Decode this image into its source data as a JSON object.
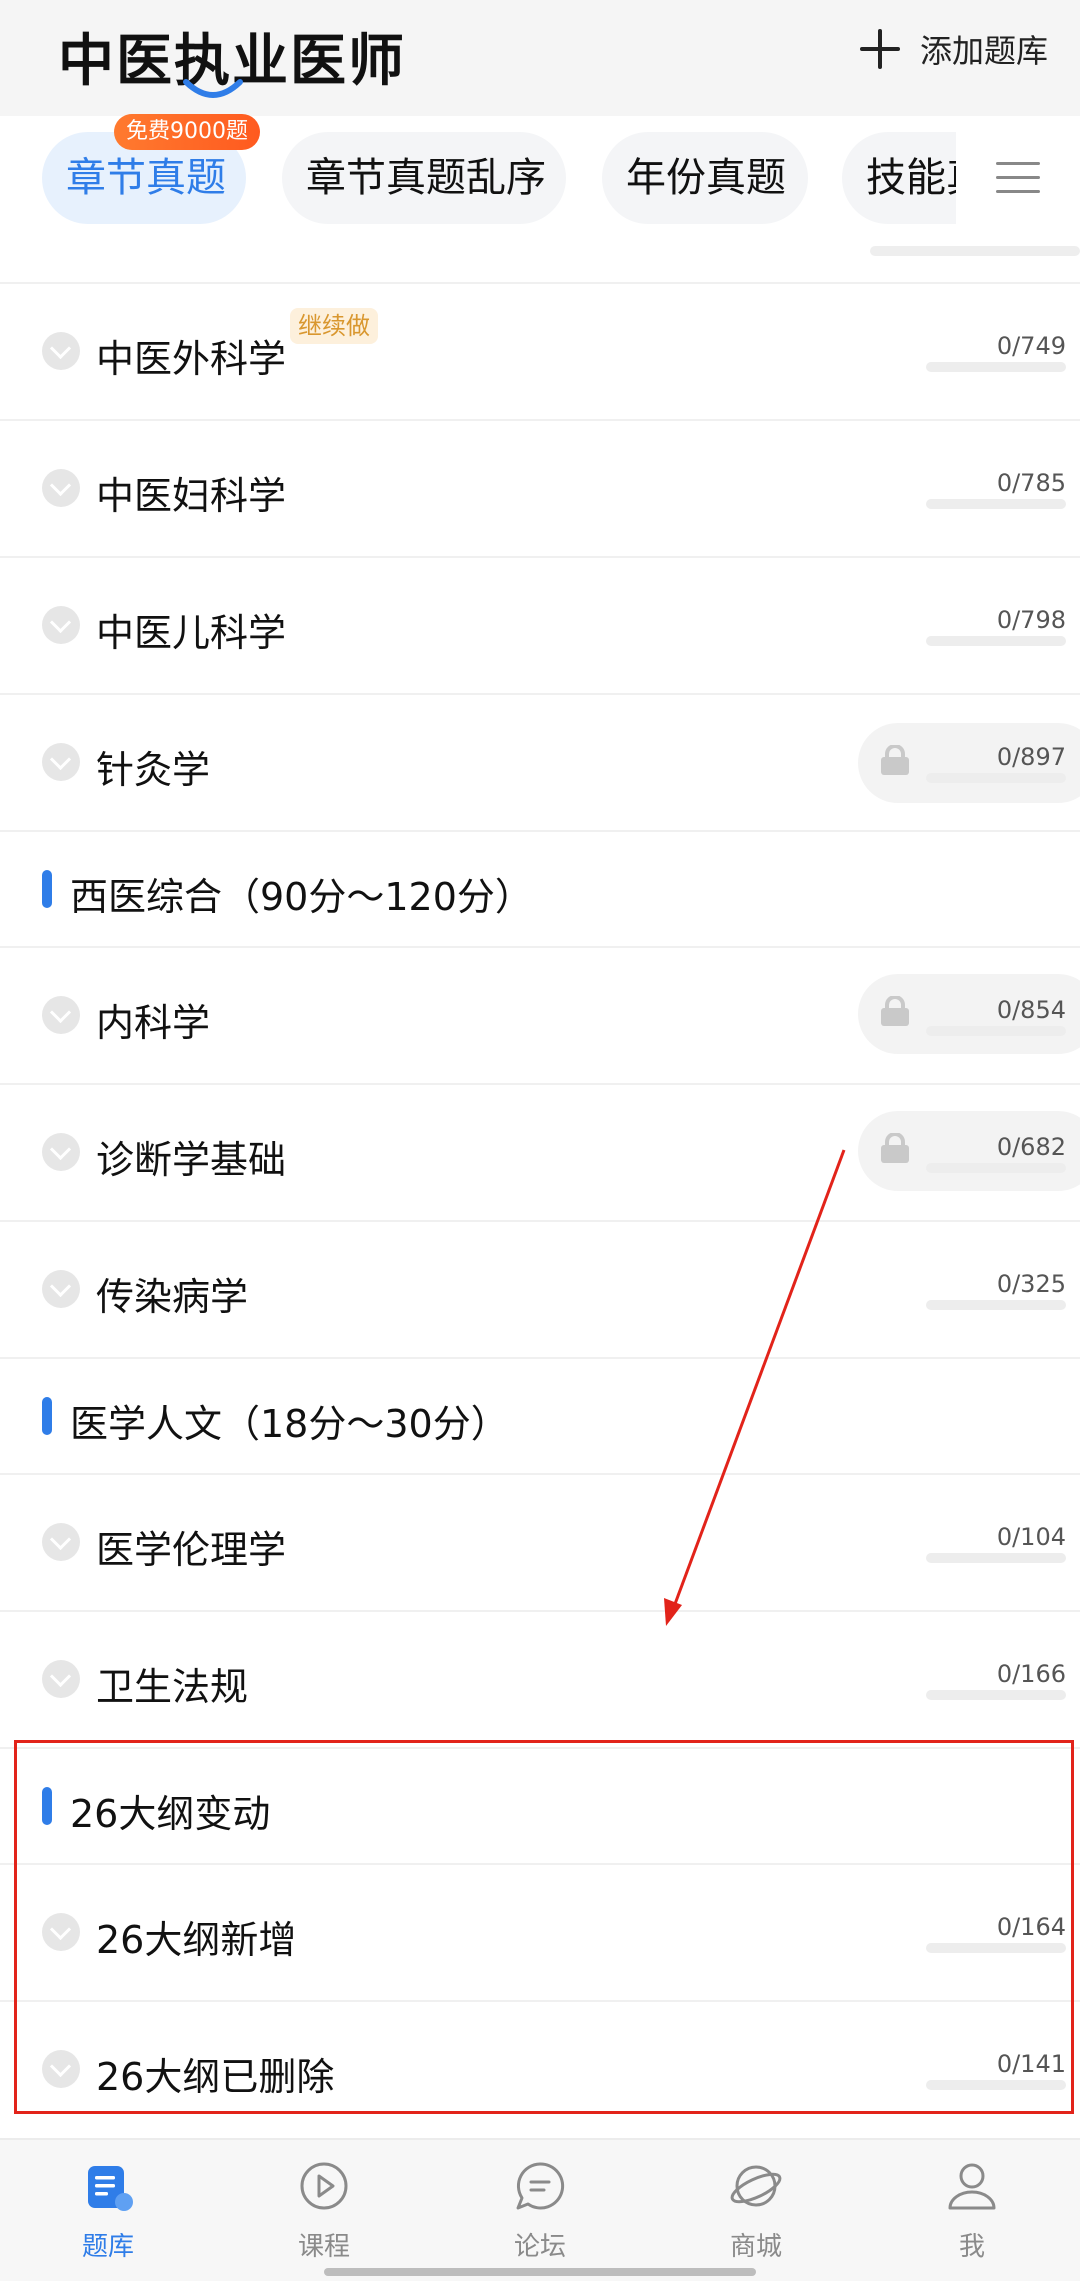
{
  "header": {
    "title": "中医执业医师",
    "add_label": "添加题库"
  },
  "tabs": [
    {
      "label": "章节真题",
      "active": true
    },
    {
      "label": "章节真题乱序"
    },
    {
      "label": "年份真题"
    },
    {
      "label": "技能真"
    }
  ],
  "tab_badge": "免费9000题",
  "continue_badge": "继续做",
  "rows": [
    {
      "name": "中医外科学",
      "count": "0/749"
    },
    {
      "name": "中医妇科学",
      "count": "0/785"
    },
    {
      "name": "中医儿科学",
      "count": "0/798"
    },
    {
      "name": "针灸学",
      "count": "0/897",
      "locked": true
    },
    {
      "name": "内科学",
      "count": "0/854",
      "locked": true
    },
    {
      "name": "诊断学基础",
      "count": "0/682",
      "locked": true
    },
    {
      "name": "传染病学",
      "count": "0/325"
    },
    {
      "name": "医学伦理学",
      "count": "0/104"
    },
    {
      "name": "卫生法规",
      "count": "0/166"
    },
    {
      "name": "26大纲新增",
      "count": "0/164"
    },
    {
      "name": "26大纲已删除",
      "count": "0/141"
    }
  ],
  "sections": [
    {
      "label": "西医综合（90分～120分）"
    },
    {
      "label": "医学人文（18分～30分）"
    },
    {
      "label": "26大纲变动"
    }
  ],
  "bottom_nav": [
    {
      "label": "题库",
      "icon": "question-bank-icon",
      "active": true
    },
    {
      "label": "课程",
      "icon": "play-course-icon"
    },
    {
      "label": "论坛",
      "icon": "forum-chat-icon"
    },
    {
      "label": "商城",
      "icon": "planet-mall-icon"
    },
    {
      "label": "我",
      "icon": "person-icon"
    }
  ],
  "colors": {
    "accent": "#2f7de8",
    "annotation_red": "#e2231a",
    "badge_orange": "#ff6a24"
  }
}
